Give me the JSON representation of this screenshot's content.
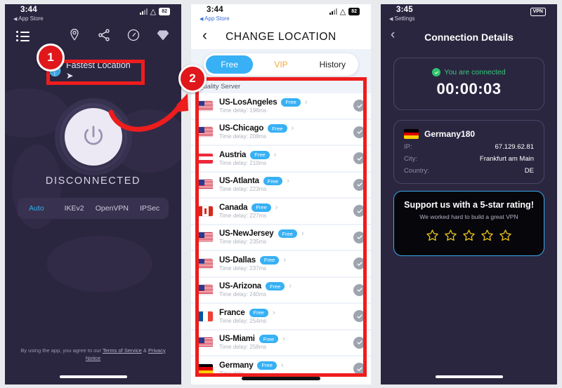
{
  "left_phone": {
    "status": {
      "time": "3:44",
      "back_label": "App Store",
      "battery": "82"
    },
    "icons": [
      "location-pin-icon",
      "share-icon",
      "speed-icon",
      "diamond-icon"
    ],
    "fastest_location_label": "Fastest Location ➤",
    "connection_state": "DISCONNECTED",
    "protocols": [
      {
        "label": "Auto",
        "active": true
      },
      {
        "label": "IKEv2",
        "active": false
      },
      {
        "label": "OpenVPN",
        "active": false
      },
      {
        "label": "IPSec",
        "active": false
      }
    ],
    "legal": {
      "prefix": "By using the app, you agree to our ",
      "terms": "Terms of Service",
      "amp": " & ",
      "privacy": "Privacy Notice"
    }
  },
  "mid_phone": {
    "status": {
      "time": "3:44",
      "back_label": "App Store",
      "battery": "82"
    },
    "title": "CHANGE LOCATION",
    "tabs": [
      {
        "label": "Free",
        "state": "active"
      },
      {
        "label": "VIP",
        "state": "vip"
      },
      {
        "label": "History",
        "state": "normal"
      }
    ],
    "section_header": "Quality Server",
    "servers": [
      {
        "name": "US-LosAngeles",
        "pill": "Free",
        "delay": "Time delay: 196ms",
        "flag": "us-flag"
      },
      {
        "name": "US-Chicago",
        "pill": "Free",
        "delay": "Time delay: 208ms",
        "flag": "us-flag"
      },
      {
        "name": "Austria",
        "pill": "Free",
        "delay": "Time delay: 210ms",
        "flag": "austria-flag"
      },
      {
        "name": "US-Atlanta",
        "pill": "Free",
        "delay": "Time delay: 223ms",
        "flag": "us-flag"
      },
      {
        "name": "Canada",
        "pill": "Free",
        "delay": "Time delay: 227ms",
        "flag": "canada-flag"
      },
      {
        "name": "US-NewJersey",
        "pill": "Free",
        "delay": "Time delay: 235ms",
        "flag": "us-flag"
      },
      {
        "name": "US-Dallas",
        "pill": "Free",
        "delay": "Time delay: 237ms",
        "flag": "us-flag"
      },
      {
        "name": "US-Arizona",
        "pill": "Free",
        "delay": "Time delay: 240ms",
        "flag": "us-flag"
      },
      {
        "name": "France",
        "pill": "Free",
        "delay": "Time delay: 254ms",
        "flag": "france-flag"
      },
      {
        "name": "US-Miami",
        "pill": "Free",
        "delay": "Time delay: 258ms",
        "flag": "us-flag"
      },
      {
        "name": "Germany",
        "pill": "Free",
        "delay": "Time dela",
        "flag": "germany-flag"
      }
    ]
  },
  "right_phone": {
    "status": {
      "time": "3:45",
      "back_label": "Settings",
      "vpn_chip": "VPN"
    },
    "title": "Connection Details",
    "connected_text": "You are connected",
    "timer": "00:00:03",
    "server": {
      "name": "Germany180",
      "rows": [
        {
          "key": "IP:",
          "value": "67.129.62.81"
        },
        {
          "key": "City:",
          "value": "Frankfurt am Main"
        },
        {
          "key": "Country:",
          "value": "DE"
        }
      ]
    },
    "rating": {
      "title": "Support us with a 5-star rating!",
      "subtitle": "We worked hard to build a great VPN",
      "stars": 5
    }
  },
  "annotations": {
    "badge_one": "1",
    "badge_two": "2",
    "accent_red": "#ee1d1d"
  }
}
